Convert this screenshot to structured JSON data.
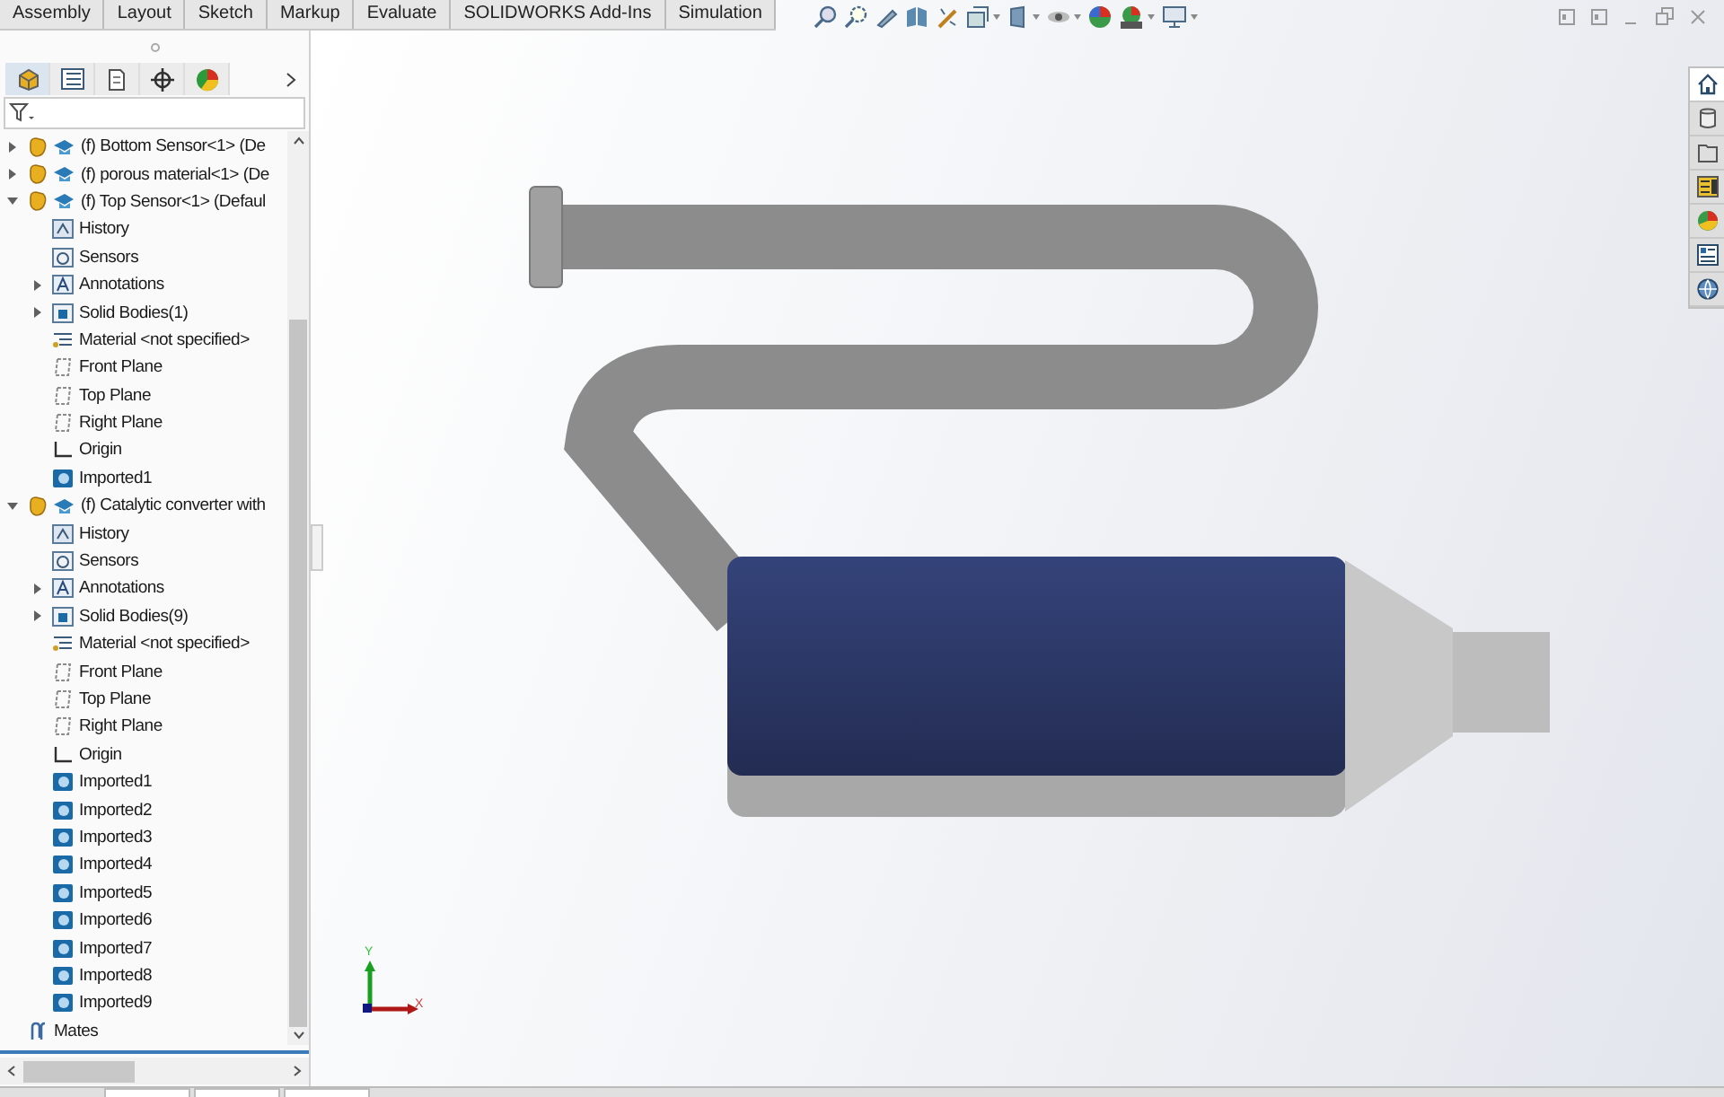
{
  "command_tabs": [
    "Assembly",
    "Layout",
    "Sketch",
    "Markup",
    "Evaluate",
    "SOLIDWORKS Add-Ins",
    "Simulation"
  ],
  "feature_tree": {
    "items": [
      {
        "kind": "component",
        "label": "(f) Bottom Sensor<1> (De",
        "expanded": false
      },
      {
        "kind": "component",
        "label": "(f) porous material<1> (De",
        "expanded": false
      },
      {
        "kind": "component",
        "label": "(f) Top Sensor<1> (Defaul",
        "expanded": true,
        "children": [
          {
            "kind": "history",
            "label": "History"
          },
          {
            "kind": "sensors",
            "label": "Sensors"
          },
          {
            "kind": "annotations",
            "label": "Annotations",
            "expanded": false
          },
          {
            "kind": "bodies",
            "label": "Solid Bodies(1)",
            "expanded": false
          },
          {
            "kind": "material",
            "label": "Material <not specified>"
          },
          {
            "kind": "plane",
            "label": "Front Plane"
          },
          {
            "kind": "plane",
            "label": "Top Plane"
          },
          {
            "kind": "plane",
            "label": "Right Plane"
          },
          {
            "kind": "origin",
            "label": "Origin"
          },
          {
            "kind": "imported",
            "label": "Imported1"
          }
        ]
      },
      {
        "kind": "component",
        "label": "(f) Catalytic converter with",
        "expanded": true,
        "children": [
          {
            "kind": "history",
            "label": "History"
          },
          {
            "kind": "sensors",
            "label": "Sensors"
          },
          {
            "kind": "annotations",
            "label": "Annotations",
            "expanded": false
          },
          {
            "kind": "bodies",
            "label": "Solid Bodies(9)",
            "expanded": false
          },
          {
            "kind": "material",
            "label": "Material <not specified>"
          },
          {
            "kind": "plane",
            "label": "Front Plane"
          },
          {
            "kind": "plane",
            "label": "Top Plane"
          },
          {
            "kind": "plane",
            "label": "Right Plane"
          },
          {
            "kind": "origin",
            "label": "Origin"
          },
          {
            "kind": "imported",
            "label": "Imported1"
          },
          {
            "kind": "imported",
            "label": "Imported2"
          },
          {
            "kind": "imported",
            "label": "Imported3"
          },
          {
            "kind": "imported",
            "label": "Imported4"
          },
          {
            "kind": "imported",
            "label": "Imported5"
          },
          {
            "kind": "imported",
            "label": "Imported6"
          },
          {
            "kind": "imported",
            "label": "Imported7"
          },
          {
            "kind": "imported",
            "label": "Imported8"
          },
          {
            "kind": "imported",
            "label": "Imported9"
          }
        ]
      },
      {
        "kind": "mates",
        "label": "Mates"
      }
    ]
  },
  "triad": {
    "y_label": "Y",
    "x_label": "X"
  }
}
